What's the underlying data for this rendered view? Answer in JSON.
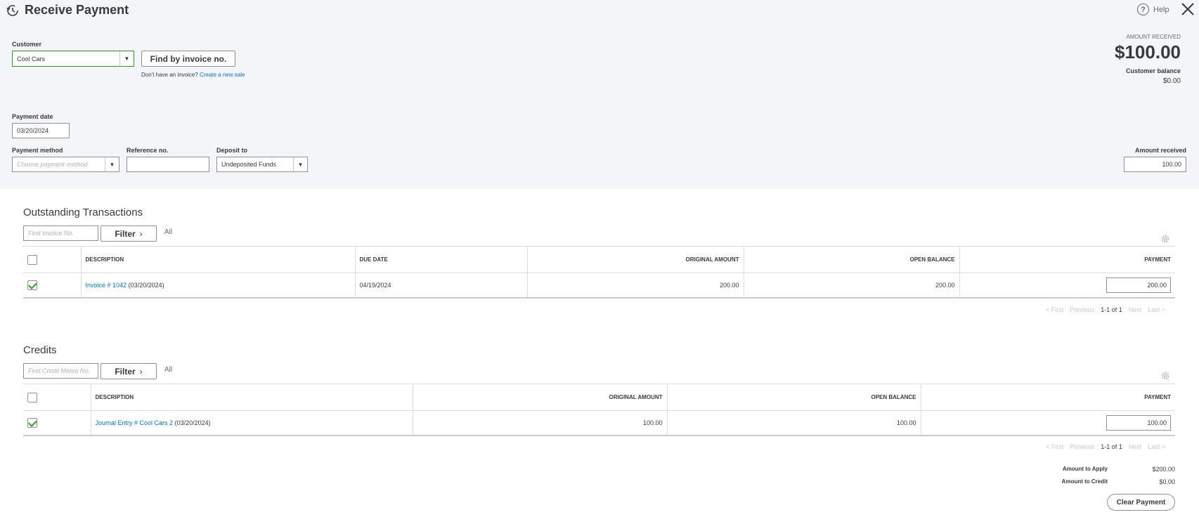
{
  "header": {
    "title": "Receive Payment",
    "help_label": "Help"
  },
  "customer": {
    "label": "Customer",
    "value": "Cool Cars",
    "find_button": "Find by invoice no.",
    "no_invoice_text": "Don't have an invoice?",
    "create_link": "Create a new sale"
  },
  "amount_summary": {
    "label": "AMOUNT RECEIVED",
    "amount": "$100.00",
    "balance_label": "Customer balance",
    "balance": "$0.00"
  },
  "payment_date": {
    "label": "Payment date",
    "value": "03/20/2024"
  },
  "payment_method": {
    "label": "Payment method",
    "placeholder": "Choose payment method"
  },
  "reference": {
    "label": "Reference no.",
    "value": ""
  },
  "deposit_to": {
    "label": "Deposit to",
    "value": "Undeposited Funds"
  },
  "amount_received": {
    "label": "Amount received",
    "value": "100.00"
  },
  "outstanding": {
    "title": "Outstanding Transactions",
    "search_placeholder": "Find Invoice No.",
    "filter_label": "Filter",
    "all_label": "All",
    "columns": {
      "description": "DESCRIPTION",
      "due_date": "DUE DATE",
      "original": "ORIGINAL AMOUNT",
      "open": "OPEN BALANCE",
      "payment": "PAYMENT"
    },
    "rows": [
      {
        "link": "Invoice # 1042",
        "date": "(03/20/2024)",
        "due": "04/19/2024",
        "original": "200.00",
        "open": "200.00",
        "payment": "200.00"
      }
    ],
    "pager": {
      "first": "< First",
      "previous": "Previous",
      "range": "1-1 of 1",
      "next": "Next",
      "last": "Last >"
    }
  },
  "credits": {
    "title": "Credits",
    "search_placeholder": "Find Credit Memo No.",
    "filter_label": "Filter",
    "all_label": "All",
    "columns": {
      "description": "DESCRIPTION",
      "original": "ORIGINAL AMOUNT",
      "open": "OPEN BALANCE",
      "payment": "PAYMENT"
    },
    "rows": [
      {
        "link": "Journal Entry # Cool Cars 2",
        "date": "(03/20/2024)",
        "original": "100.00",
        "open": "100.00",
        "payment": "100.00"
      }
    ],
    "pager": {
      "first": "< First",
      "previous": "Previous",
      "range": "1-1 of 1",
      "next": "Next",
      "last": "Last >"
    }
  },
  "totals": {
    "apply_label": "Amount to Apply",
    "apply_value": "$200.00",
    "credit_label": "Amount to Credit",
    "credit_value": "$0.00",
    "clear_button": "Clear Payment"
  }
}
